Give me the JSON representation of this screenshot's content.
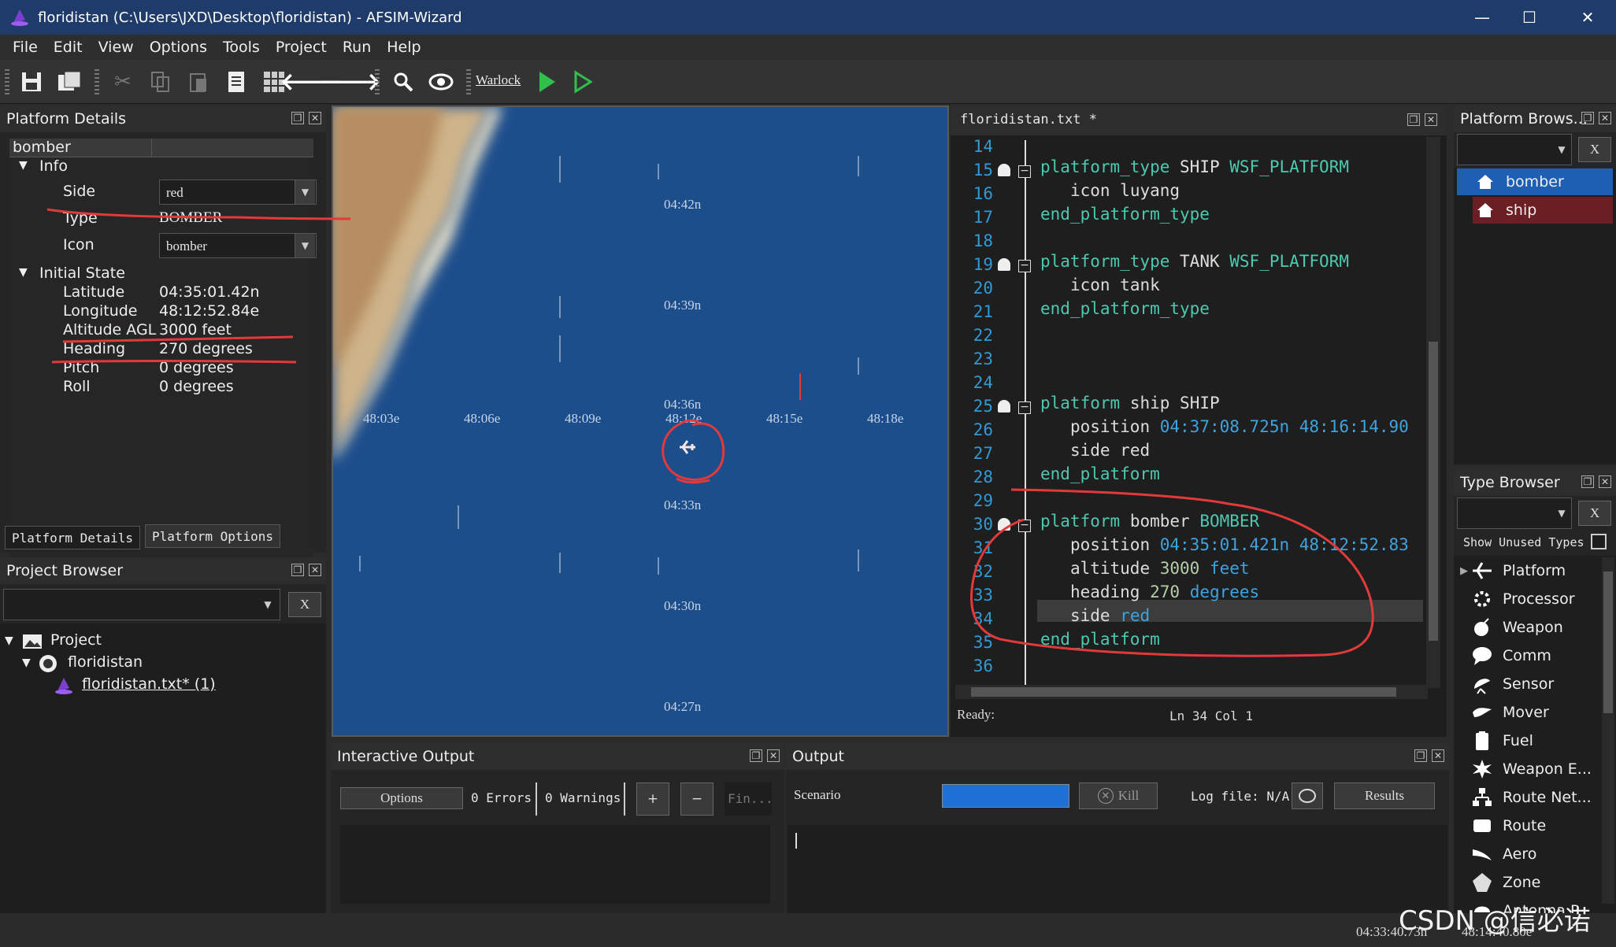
{
  "window": {
    "title": "floridistan (C:\\Users\\JXD\\Desktop\\floridistan) - AFSIM-Wizard",
    "minimize": "—",
    "maximize": "☐",
    "close": "✕"
  },
  "menu": [
    "File",
    "Edit",
    "View",
    "Options",
    "Tools",
    "Project",
    "Run",
    "Help"
  ],
  "toolbar": {
    "warlock_label": "Warlock"
  },
  "platform_details": {
    "title": "Platform Details",
    "name": "bomber",
    "info_label": "Info",
    "side_label": "Side",
    "side_value": "red",
    "type_label": "Type",
    "type_value": "BOMBER",
    "icon_label": "Icon",
    "icon_value": "bomber",
    "initial_state_label": "Initial State",
    "latitude_label": "Latitude",
    "latitude_value": "04:35:01.42n",
    "longitude_label": "Longitude",
    "longitude_value": "48:12:52.84e",
    "altitude_label": "Altitude AGL",
    "altitude_value": "3000 feet",
    "heading_label": "Heading",
    "heading_value": "270 degrees",
    "pitch_label": "Pitch",
    "pitch_value": "0 degrees",
    "roll_label": "Roll",
    "roll_value": "0 degrees",
    "tabs": [
      "Platform Details",
      "Platform Options"
    ]
  },
  "project_browser": {
    "title": "Project Browser",
    "clear": "X",
    "project": "Project",
    "folder": "floridistan",
    "file": "floridistan.txt* (1)"
  },
  "map": {
    "lat_labels": [
      "04:42n",
      "04:39n",
      "04:36n",
      "04:33n",
      "04:30n",
      "04:27n"
    ],
    "lon_labels": [
      "48:03e",
      "48:06e",
      "48:09e",
      "48:12e",
      "48:15e",
      "48:18e"
    ]
  },
  "editor": {
    "tab_title": "floridistan.txt *",
    "line_numbers": [
      "14",
      "15",
      "16",
      "17",
      "18",
      "19",
      "20",
      "21",
      "22",
      "23",
      "24",
      "25",
      "26",
      "27",
      "28",
      "29",
      "30",
      "31",
      "32",
      "33",
      "34",
      "35",
      "36"
    ],
    "l15a": "platform_type",
    "l15b": "SHIP",
    "l15c": "WSF_PLATFORM",
    "l16a": "icon",
    "l16b": "luyang",
    "l17": "end_platform_type",
    "l19a": "platform_type",
    "l19b": "TANK",
    "l19c": "WSF_PLATFORM",
    "l20a": "icon",
    "l20b": "tank",
    "l21": "end_platform_type",
    "l25a": "platform",
    "l25b": "ship",
    "l25c": "SHIP",
    "l26a": "position",
    "l26b": "04:37:08.725n 48:16:14.90",
    "l27a": "side",
    "l27b": "red",
    "l28": "end_platform",
    "l30a": "platform",
    "l30b": "bomber",
    "l30c": "BOMBER",
    "l31a": "position",
    "l31b": "04:35:01.421n 48:12:52.83",
    "l32a": "altitude",
    "l32b": "3000",
    "l32c": "feet",
    "l33a": "heading",
    "l33b": "270",
    "l33c": "degrees",
    "l34a": "side",
    "l34b": "red",
    "l35": "end_platform",
    "status": "Ready:",
    "cursor": "Ln 34  Col 1"
  },
  "platform_browser": {
    "title": "Platform Brows...",
    "clear": "X",
    "items": [
      "bomber",
      "ship"
    ]
  },
  "type_browser": {
    "title": "Type Browser",
    "clear": "X",
    "show_unused": "Show Unused Types",
    "items": [
      "Platform",
      "Processor",
      "Weapon",
      "Comm",
      "Sensor",
      "Mover",
      "Fuel",
      "Weapon E...",
      "Route Net...",
      "Route",
      "Aero",
      "Zone",
      "Antenna P..."
    ]
  },
  "interactive_output": {
    "title": "Interactive Output",
    "options": "Options",
    "errors": "0 Errors",
    "warnings": "0 Warnings",
    "plus": "+",
    "minus": "−",
    "find": "Fin..."
  },
  "output": {
    "title": "Output",
    "scenario": "Scenario",
    "kill": "Kill",
    "logfile": "Log file: N/A",
    "results": "Results"
  },
  "statusbar": {
    "lat": "04:33:40.73n",
    "lon": "48:14:40.80e"
  },
  "watermark": "CSDN @信必诺",
  "colors": {
    "title_bar": "#1f3b69",
    "selected": "#1e5fb4",
    "ship_row": "#6b1e24",
    "annotation": "#e23a3a",
    "map_sea": "#1d4e8c",
    "run_green": "#2fbf4a"
  }
}
